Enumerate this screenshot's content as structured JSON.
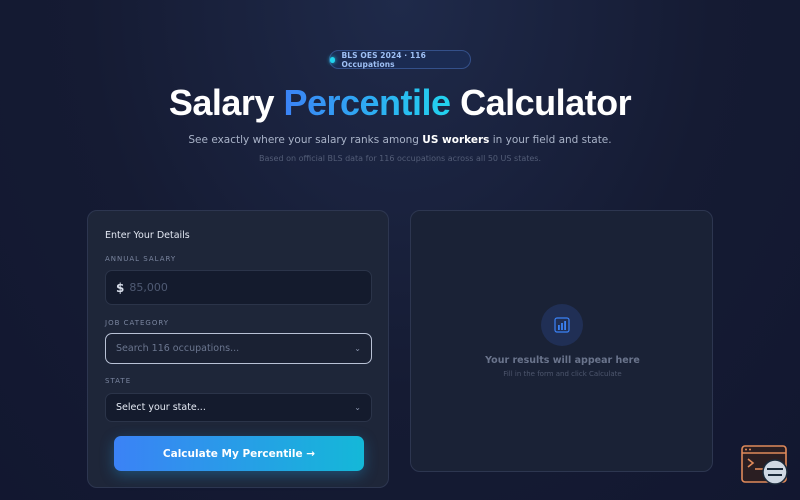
{
  "badge": {
    "text": "BLS OES 2024 · 116 Occupations"
  },
  "hero": {
    "title_part1": "Salary ",
    "title_accent": "Percentile",
    "title_part3": " Calculator",
    "subtitle_before": "See exactly where your salary ranks among ",
    "subtitle_strong": "US workers",
    "subtitle_after": " in your field and state.",
    "note": "Based on official BLS data for 116 occupations across all 50 US states."
  },
  "form": {
    "title": "Enter Your Details",
    "salary_label": "Annual Salary",
    "salary_prefix": "$",
    "salary_placeholder": "85,000",
    "job_label": "Job Category",
    "job_placeholder": "Search 116 occupations...",
    "state_label": "State",
    "state_value": "Select your state...",
    "submit_label": "Calculate My Percentile →"
  },
  "results": {
    "title": "Your results will appear here",
    "subtitle": "Fill in the form and click Calculate",
    "icon": "bar-chart-icon"
  },
  "colors": {
    "accent_blue": "#3b82f6",
    "accent_cyan": "#22d3ee",
    "background": "#151b33"
  }
}
